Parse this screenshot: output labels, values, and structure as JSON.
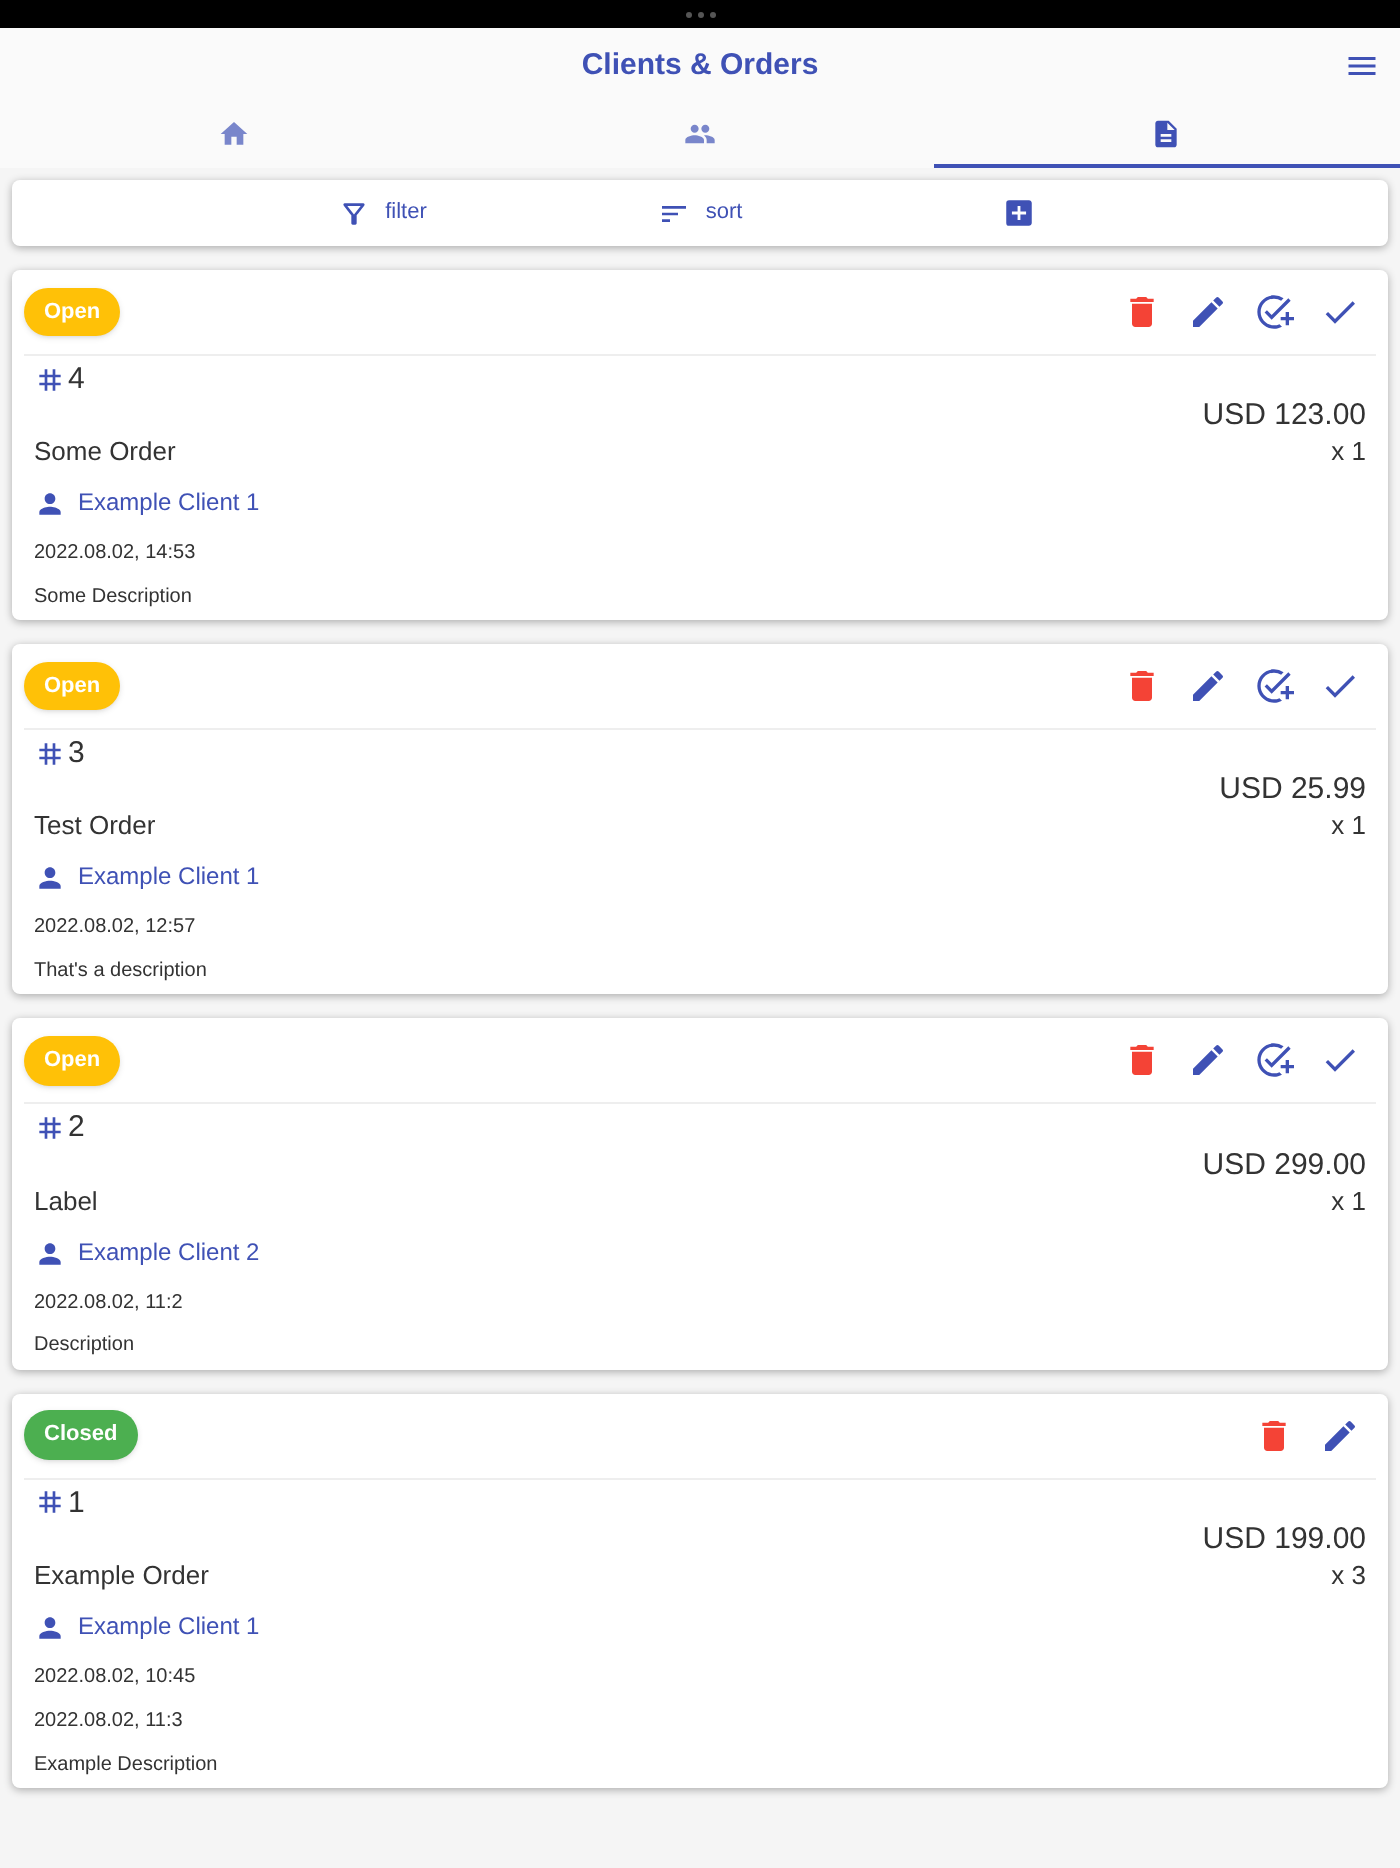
{
  "header": {
    "title": "Clients & Orders"
  },
  "tabs": [
    {
      "kind": "home",
      "selected": false
    },
    {
      "kind": "people",
      "selected": false
    },
    {
      "kind": "document",
      "selected": true
    }
  ],
  "toolbar": [
    {
      "kind": "filter",
      "label": "filter"
    },
    {
      "kind": "sort",
      "label": "sort"
    },
    {
      "kind": "add"
    }
  ],
  "orders": [
    {
      "status": {
        "kind": "open",
        "label": "Open"
      },
      "actions": [
        {
          "kind": "delete"
        },
        {
          "kind": "edit"
        },
        {
          "kind": "add-task"
        },
        {
          "kind": "check"
        }
      ],
      "number": "4",
      "price": "USD 123.00",
      "name": "Some Order",
      "quantity": "x 1",
      "client": "Example Client 1",
      "dates": [
        "2022.08.02, 14:53"
      ],
      "description": "Some Description"
    },
    {
      "status": {
        "kind": "open",
        "label": "Open"
      },
      "actions": [
        {
          "kind": "delete"
        },
        {
          "kind": "edit"
        },
        {
          "kind": "add-task"
        },
        {
          "kind": "check"
        }
      ],
      "number": "3",
      "price": "USD 25.99",
      "name": "Test Order",
      "quantity": "x 1",
      "client": "Example Client 1",
      "dates": [
        "2022.08.02, 12:57"
      ],
      "description": "That's a description"
    },
    {
      "status": {
        "kind": "open",
        "label": "Open"
      },
      "actions": [
        {
          "kind": "delete"
        },
        {
          "kind": "edit"
        },
        {
          "kind": "add-task"
        },
        {
          "kind": "check"
        }
      ],
      "number": "2",
      "price": "USD 299.00",
      "name": "Label",
      "quantity": "x 1",
      "client": "Example Client 2",
      "dates": [
        "2022.08.02, 11:2"
      ],
      "description": "Description"
    },
    {
      "status": {
        "kind": "closed",
        "label": "Closed"
      },
      "actions": [
        {
          "kind": "delete"
        },
        {
          "kind": "edit"
        }
      ],
      "number": "1",
      "price": "USD 199.00",
      "name": "Example Order",
      "quantity": "x 3",
      "client": "Example Client 1",
      "dates": [
        "2022.08.02, 10:45",
        "2022.08.02, 11:3"
      ],
      "description": "Example Description"
    }
  ]
}
